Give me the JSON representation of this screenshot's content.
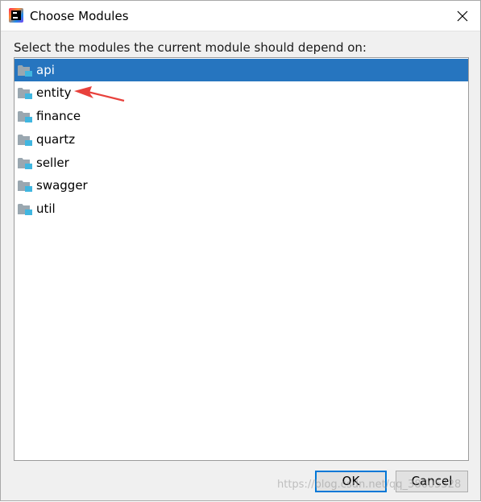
{
  "window": {
    "title": "Choose Modules",
    "app_icon": "intellij-idea-icon",
    "close_icon": "close-icon"
  },
  "instructions": "Select the modules the current module should depend on:",
  "modules": [
    {
      "label": "api",
      "icon": "module-folder-icon",
      "selected": true
    },
    {
      "label": "entity",
      "icon": "module-folder-icon",
      "selected": false
    },
    {
      "label": "finance",
      "icon": "module-folder-icon",
      "selected": false
    },
    {
      "label": "quartz",
      "icon": "module-folder-icon",
      "selected": false
    },
    {
      "label": "seller",
      "icon": "module-folder-icon",
      "selected": false
    },
    {
      "label": "swagger",
      "icon": "module-folder-icon",
      "selected": false
    },
    {
      "label": "util",
      "icon": "module-folder-icon",
      "selected": false
    }
  ],
  "annotation": {
    "type": "red-arrow",
    "points_to": "entity",
    "color": "#e8413c"
  },
  "buttons": {
    "ok_label": "OK",
    "cancel_label": "Cancel"
  },
  "watermark": "https://blog.csdn.net/qq_38605328",
  "colors": {
    "selection": "#2675bf",
    "folder_gray": "#9aa7b0",
    "folder_blue": "#40b6e0",
    "ok_border": "#0078d7"
  }
}
